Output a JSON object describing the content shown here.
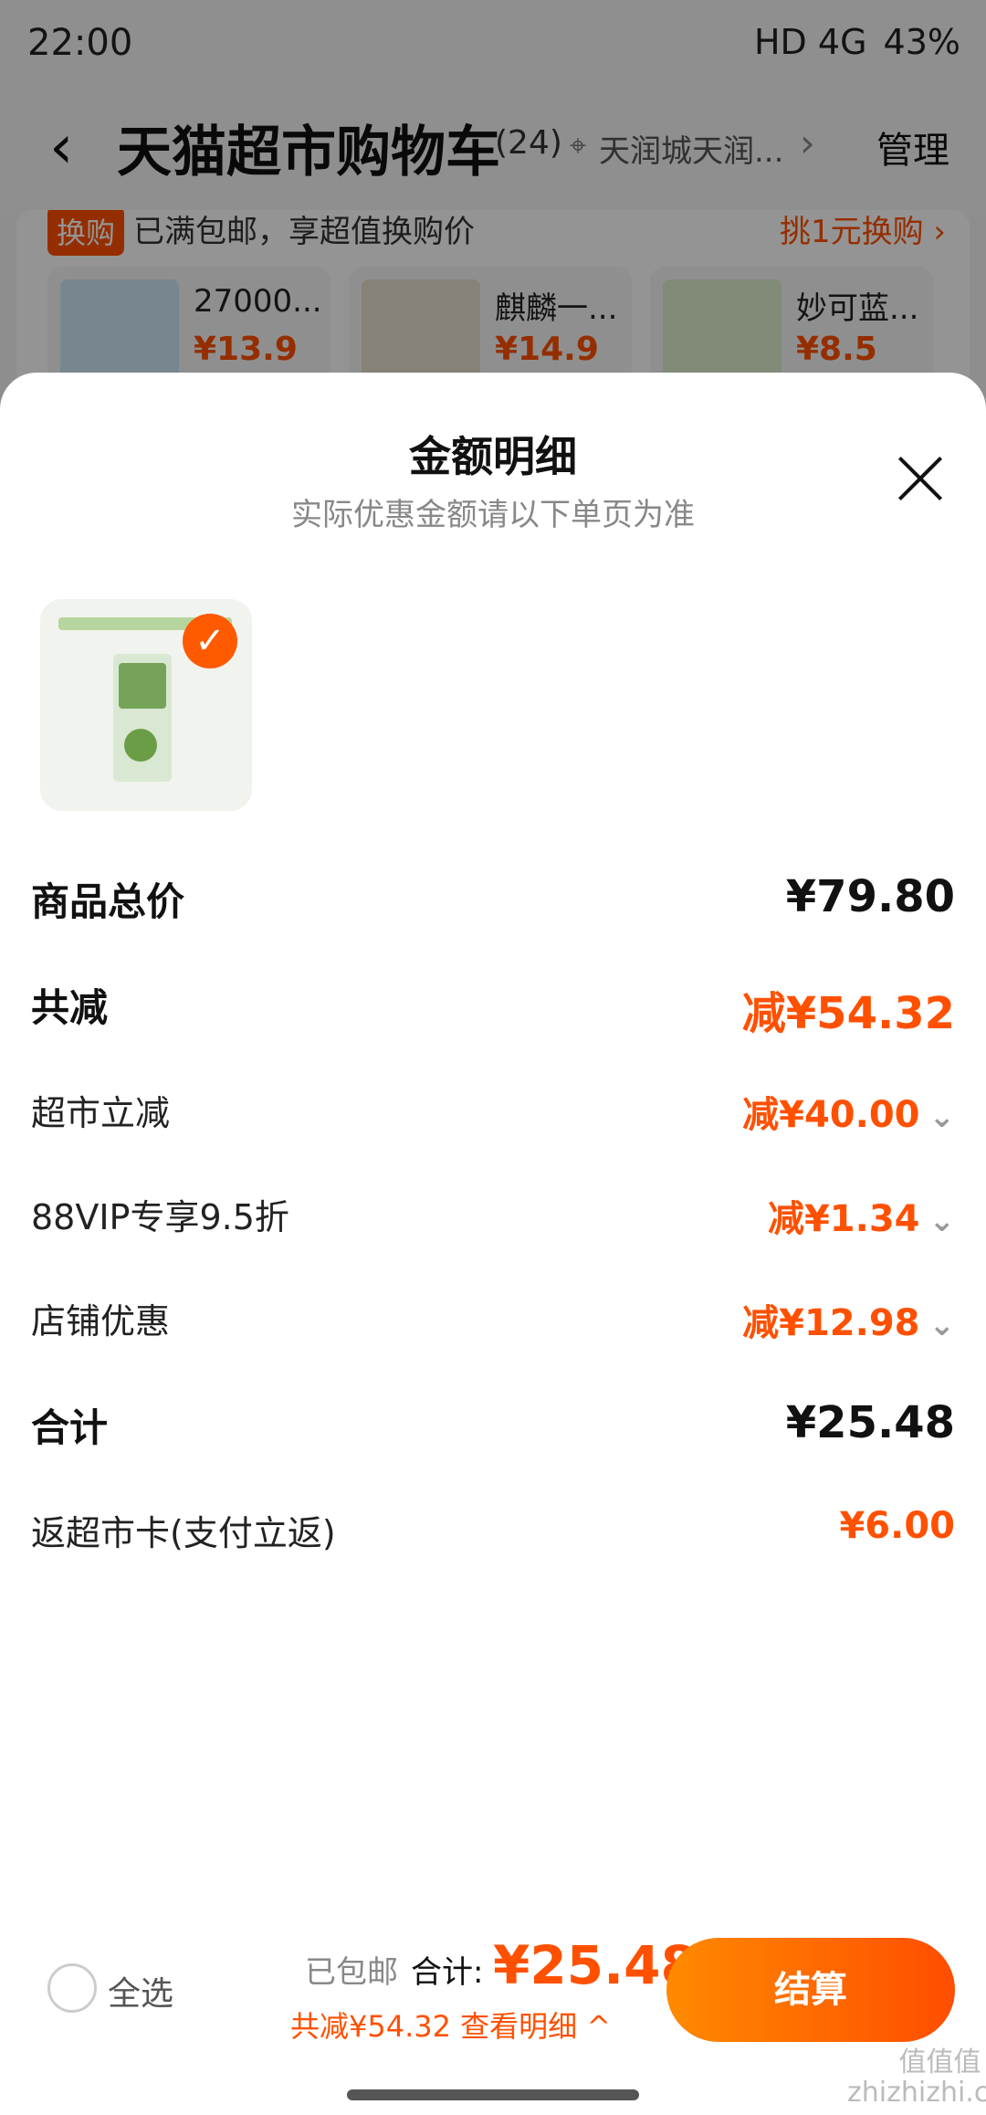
{
  "status": {
    "time": "22:00",
    "battery": "43%",
    "net": "HD 4G"
  },
  "header": {
    "back_icon": "‹",
    "title": "天猫超市购物车",
    "count": "(24)",
    "location": "天润城天润...",
    "chevron": "›",
    "manage": "管理"
  },
  "promo": {
    "tag": "换购",
    "text": "已满包邮，享超值换购价",
    "link": "挑1元换购 ›",
    "items": [
      {
        "name": "27000...",
        "price": "¥13.9",
        "color": "#cfe7f6"
      },
      {
        "name": "麒麟一...",
        "price": "¥14.9",
        "color": "#e9e0cf"
      },
      {
        "name": "妙可蓝...",
        "price": "¥8.5",
        "color": "#dff0cf"
      }
    ]
  },
  "sheet": {
    "title": "金额明细",
    "subtitle": "实际优惠金额请以下单页为准",
    "product_check": "✓",
    "rows": [
      {
        "label": "商品总价",
        "value": "¥79.80"
      },
      {
        "label": "共减",
        "value": "减¥54.32"
      },
      {
        "label": "超市立减",
        "value": "减¥40.00"
      },
      {
        "label": "88VIP专享9.5折",
        "value": "减¥1.34"
      },
      {
        "label": "店铺优惠",
        "value": "减¥12.98"
      },
      {
        "label": "合计",
        "value": "¥25.48"
      },
      {
        "label": "返超市卡(支付立返)",
        "value": "¥6.00"
      }
    ]
  },
  "bottom": {
    "select_all": "全选",
    "shipped": "已包邮",
    "total_label": "合计:",
    "total_value": "¥25.48",
    "detail": "共减¥54.32 查看明细 ^",
    "checkout": "结算"
  },
  "watermark": {
    "line1": "值值值",
    "line2": "zhizhizhi.com"
  }
}
